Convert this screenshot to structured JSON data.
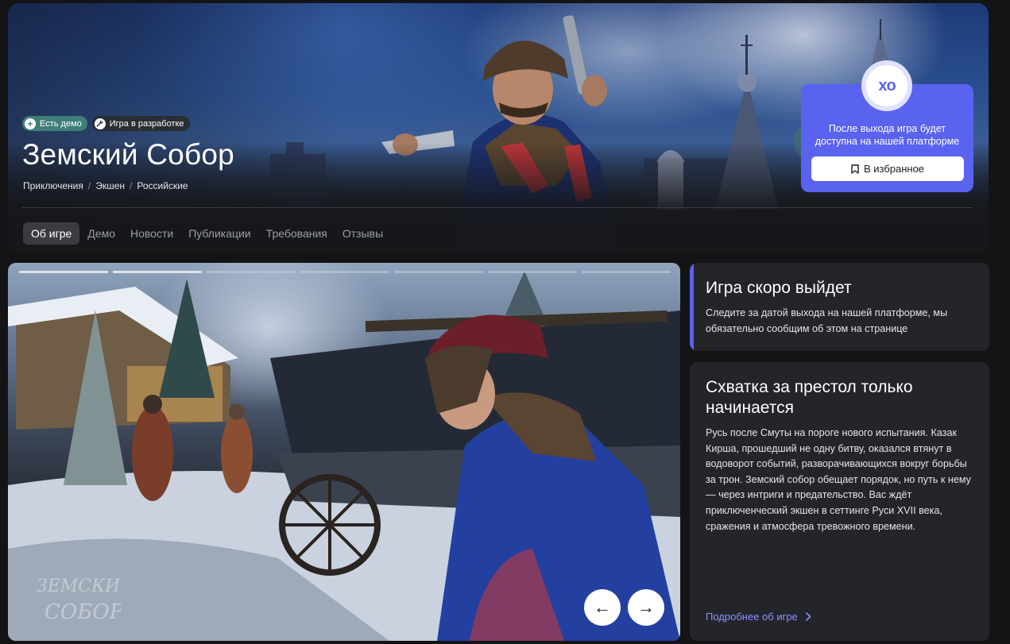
{
  "hero": {
    "badges": [
      {
        "label": "Есть демо",
        "icon": "plus-icon"
      },
      {
        "label": "Игра в разработке",
        "icon": "wrench-icon"
      }
    ],
    "title": "Земский Собор",
    "genres": [
      "Приключения",
      "Экшен",
      "Российские"
    ],
    "genre_separator": "/"
  },
  "notify": {
    "logo_text": "xo",
    "text": "После выхода игра будет доступна на нашей платформе",
    "favorite_label": "В избранное",
    "accent_color": "#5a62f0"
  },
  "tabs": [
    {
      "label": "Об игре",
      "active": true
    },
    {
      "label": "Демо",
      "active": false
    },
    {
      "label": "Новости",
      "active": false
    },
    {
      "label": "Публикации",
      "active": false
    },
    {
      "label": "Требования",
      "active": false
    },
    {
      "label": "Отзывы",
      "active": false
    }
  ],
  "gallery": {
    "slide_count": 7,
    "current_slide": 2,
    "prev_icon": "arrow-left-icon",
    "next_icon": "arrow-right-icon",
    "prev_glyph": "←",
    "next_glyph": "→",
    "watermark": "ЗЕМСКИЙ СОБОР"
  },
  "coming_soon": {
    "title": "Игра скоро выйдет",
    "text": "Следите за датой выхода на нашей платформе, мы обязательно сообщим об этом на странице"
  },
  "about": {
    "title": "Схватка за престол только начинается",
    "text": "Русь после Смуты на пороге нового испытания. Казак Кирша, прошедший не одну битву, оказался втянут в водоворот событий, разворачивающихся вокруг борьбы за трон. Земский собор обещает порядок, но путь к нему — через интриги и предательство. Вас ждёт приключенческий экшен в сеттинге Руси XVII века, сражения и атмосфера тревожного времени.",
    "more_label": "Подробнее об игре",
    "link_color": "#8b93ff"
  }
}
